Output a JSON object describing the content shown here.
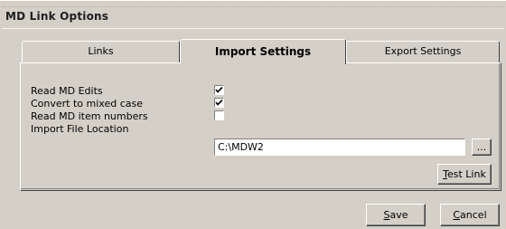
{
  "window": {
    "title": "MD Link Options"
  },
  "tabs": [
    {
      "label": "Links",
      "active": false
    },
    {
      "label": "Import Settings",
      "active": true
    },
    {
      "label": "Export Settings",
      "active": false
    }
  ],
  "import_settings": {
    "read_md_edits": {
      "label": "Read MD Edits",
      "checked": true
    },
    "convert_mixed_case": {
      "label": "Convert to mixed case",
      "checked": true
    },
    "read_md_item_numbers": {
      "label": "Read MD item numbers",
      "checked": false
    },
    "import_location": {
      "label": "Import File Location",
      "value": "C:\\MDW2"
    },
    "browse_label": "...",
    "test_link": {
      "accel": "T",
      "rest": "est Link"
    }
  },
  "footer": {
    "save": {
      "accel": "S",
      "rest": "ave"
    },
    "cancel": {
      "accel": "C",
      "rest": "ancel"
    }
  }
}
